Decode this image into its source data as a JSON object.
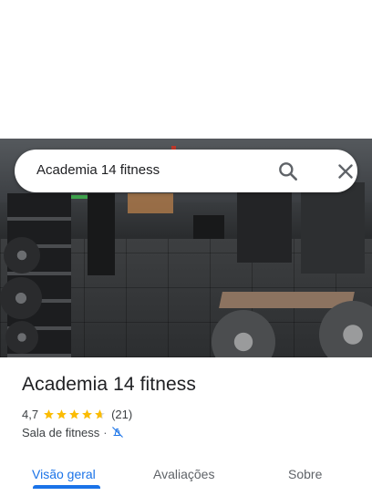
{
  "search": {
    "query": "Academia 14 fitness",
    "search_icon": "search-icon",
    "close_icon": "close-icon"
  },
  "place": {
    "photo_icon": "gym-photo",
    "name": "Academia 14 fitness",
    "rating": "4,7",
    "stars": 4.7,
    "review_count": "(21)",
    "category": "Sala de fitness",
    "separator": "·",
    "attribute_icon": "no-delivery-icon"
  },
  "tabs": [
    {
      "label": "Visão geral",
      "active": true
    },
    {
      "label": "Avaliações",
      "active": false
    },
    {
      "label": "Sobre",
      "active": false
    }
  ],
  "colors": {
    "accent": "#1a73e8",
    "star": "#fbbc04",
    "text": "#202124"
  }
}
